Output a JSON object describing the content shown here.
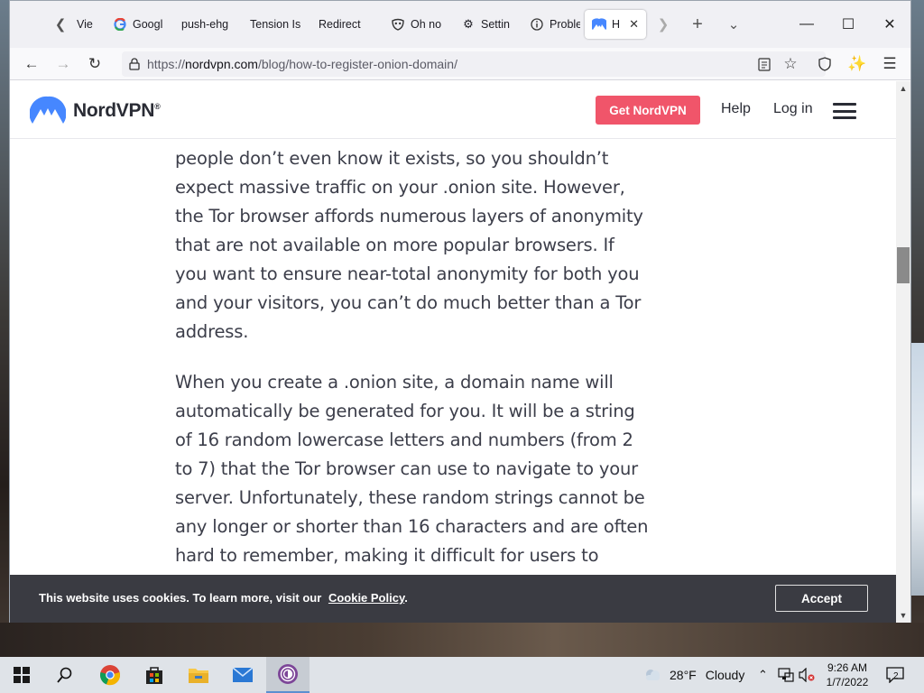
{
  "browser": {
    "tabs": [
      {
        "label": "Vie",
        "icon": "back-chevron-icon"
      },
      {
        "label": "Googl",
        "icon": "google-icon"
      },
      {
        "label": "push-ehg",
        "icon": ""
      },
      {
        "label": "Tension Is",
        "icon": ""
      },
      {
        "label": "Redirect",
        "icon": ""
      },
      {
        "label": "Oh no",
        "icon": "mask-icon"
      },
      {
        "label": "Settin",
        "icon": "gear-icon"
      },
      {
        "label": "Proble",
        "icon": "info-icon"
      },
      {
        "label": "Ho",
        "icon": "nordvpn-icon"
      }
    ],
    "url_prefix": "https://",
    "url_domain": "nordvpn.com",
    "url_path": "/blog/how-to-register-onion-domain/"
  },
  "site": {
    "brand": "NordVPN",
    "reg": "®",
    "cta": "Get NordVPN",
    "help": "Help",
    "login": "Log in",
    "partial_line": "...",
    "paragraphs": [
      [
        "people don’t even know it exists, so you shouldn’t",
        "expect massive traffic on your .onion site. However,",
        "the Tor browser affords numerous layers of anonymity",
        "that are not available on more popular browsers. If",
        "you want to ensure near-total anonymity for both you",
        "and your visitors, you can’t do much better than a Tor",
        "address."
      ],
      [
        "When you create a .onion site, a domain name will",
        "automatically be generated for you. It will be a string",
        "of 16 random lowercase letters and numbers (from 2",
        "to 7) that the Tor browser can use to navigate to your",
        "server. Unfortunately, these random strings cannot be",
        "any longer or shorter than 16 characters and are often",
        "hard to remember, making it difficult for users to"
      ]
    ],
    "cookie": {
      "message": "This website uses cookies. To learn more, visit our",
      "link": "Cookie Policy",
      "after": ".",
      "accept": "Accept"
    }
  },
  "taskbar": {
    "weather_temp": "28°F",
    "weather_cond": "Cloudy",
    "time": "9:26 AM",
    "date": "1/7/2022",
    "notifications": "2"
  },
  "colors": {
    "cta": "#f0556a",
    "brand_blue": "#4687ff",
    "cookie_bg": "#3a3b42"
  }
}
